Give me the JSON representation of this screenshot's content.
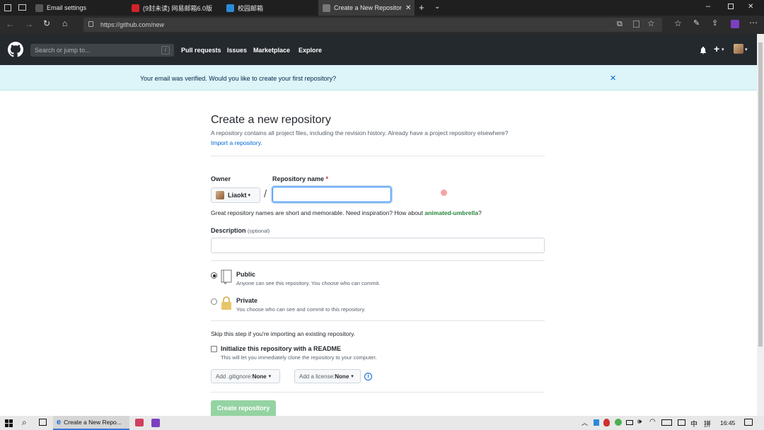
{
  "browser": {
    "tabs": [
      {
        "title": "Email settings"
      },
      {
        "title": "(9封未读) 网易邮箱6.0版"
      },
      {
        "title": "校园邮箱"
      },
      {
        "title": "Create a New Repositor"
      }
    ],
    "url": "https://github.com/new"
  },
  "github": {
    "search_placeholder": "Search or jump to...",
    "search_key": "/",
    "nav": [
      "Pull requests",
      "Issues",
      "Marketplace",
      "Explore"
    ]
  },
  "flash": {
    "message": "Your email was verified. Would you like to create your first repository?"
  },
  "form": {
    "title": "Create a new repository",
    "intro": "A repository contains all project files, including the revision history. Already have a project repository elsewhere?",
    "import_link": "Import a repository.",
    "owner_label": "Owner",
    "owner_value": "Liaokt",
    "slash": "/",
    "repo_label": "Repository name",
    "required_mark": "*",
    "repo_value": "",
    "inspiration_prefix": "Great repository names are short and memorable. Need inspiration? How about ",
    "inspiration_name": "animated-umbrella",
    "inspiration_suffix": "?",
    "description_label": "Description",
    "description_optional": "(optional)",
    "description_value": "",
    "visibility": [
      {
        "title": "Public",
        "desc": "Anyone can see this repository. You choose who can commit.",
        "selected": true
      },
      {
        "title": "Private",
        "desc": "You choose who can see and commit to this repository.",
        "selected": false
      }
    ],
    "skip_note": "Skip this step if you're importing an existing repository.",
    "readme_label": "Initialize this repository with a README",
    "readme_desc": "This will let you immediately clone the repository to your computer.",
    "gitignore_prefix": "Add .gitignore: ",
    "gitignore_value": "None",
    "license_prefix": "Add a license: ",
    "license_value": "None",
    "submit_label": "Create repository"
  },
  "taskbar": {
    "app_label": "Create a New Repo...",
    "ime": "中",
    "ime2": "拼",
    "time": "16:45"
  },
  "colors": {
    "header_bg": "#24292e",
    "flash_bg": "#ddf4f8",
    "link": "#0366d6",
    "submit_disabled": "#94d3a2",
    "inspiration_green": "#22863a"
  }
}
